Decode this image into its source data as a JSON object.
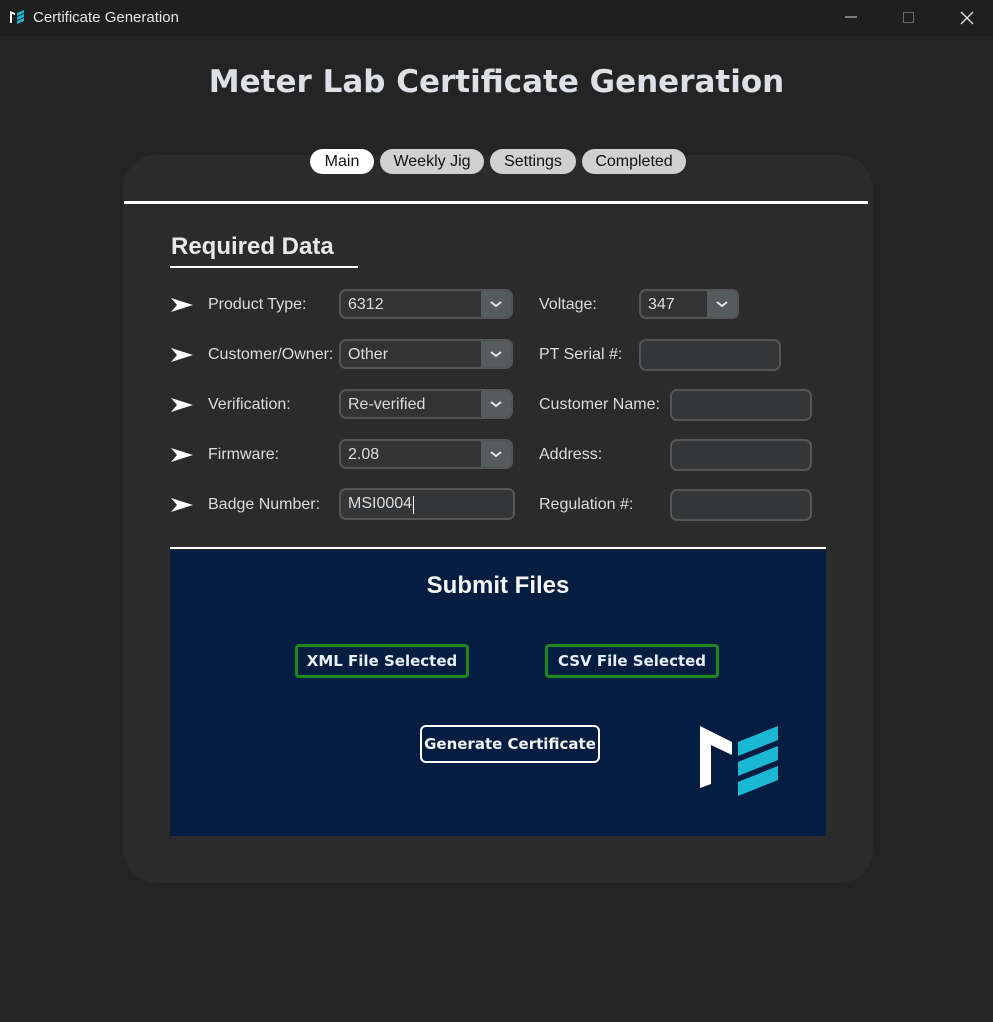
{
  "window": {
    "title": "Certificate Generation",
    "controls": [
      "minimize-icon",
      "maximize-icon",
      "close-icon"
    ]
  },
  "heading": "Meter Lab Certificate Generation",
  "tabs": [
    {
      "label": "Main",
      "active": true
    },
    {
      "label": "Weekly Jig",
      "active": false
    },
    {
      "label": "Settings",
      "active": false
    },
    {
      "label": "Completed",
      "active": false
    }
  ],
  "required": {
    "title": "Required Data",
    "left": [
      {
        "label": "Product Type:",
        "value": "6312",
        "kind": "dropdown"
      },
      {
        "label": "Customer/Owner:",
        "value": "Other",
        "kind": "dropdown"
      },
      {
        "label": "Verification:",
        "value": "Re-verified",
        "kind": "dropdown"
      },
      {
        "label": "Firmware:",
        "value": "2.08",
        "kind": "dropdown"
      },
      {
        "label": "Badge Number:",
        "value": "MSI0004",
        "kind": "text"
      }
    ],
    "right": [
      {
        "label": "Voltage:",
        "value": "347",
        "kind": "dropdown"
      },
      {
        "label": "PT Serial #:",
        "value": "",
        "kind": "text"
      },
      {
        "label": "Customer Name:",
        "value": "",
        "kind": "text"
      },
      {
        "label": "Address:",
        "value": "",
        "kind": "text"
      },
      {
        "label": "Regulation #:",
        "value": "",
        "kind": "text"
      }
    ]
  },
  "submit": {
    "title": "Submit Files",
    "xml_button": "XML File Selected",
    "csv_button": "CSV File Selected",
    "generate_button": "Generate Certificate"
  },
  "colors": {
    "background": "#242424",
    "panel": "#2b2b2b",
    "submit_bg": "#051d40",
    "selected_border": "#1a8a1a",
    "logo_accent": "#1bb8d6"
  }
}
